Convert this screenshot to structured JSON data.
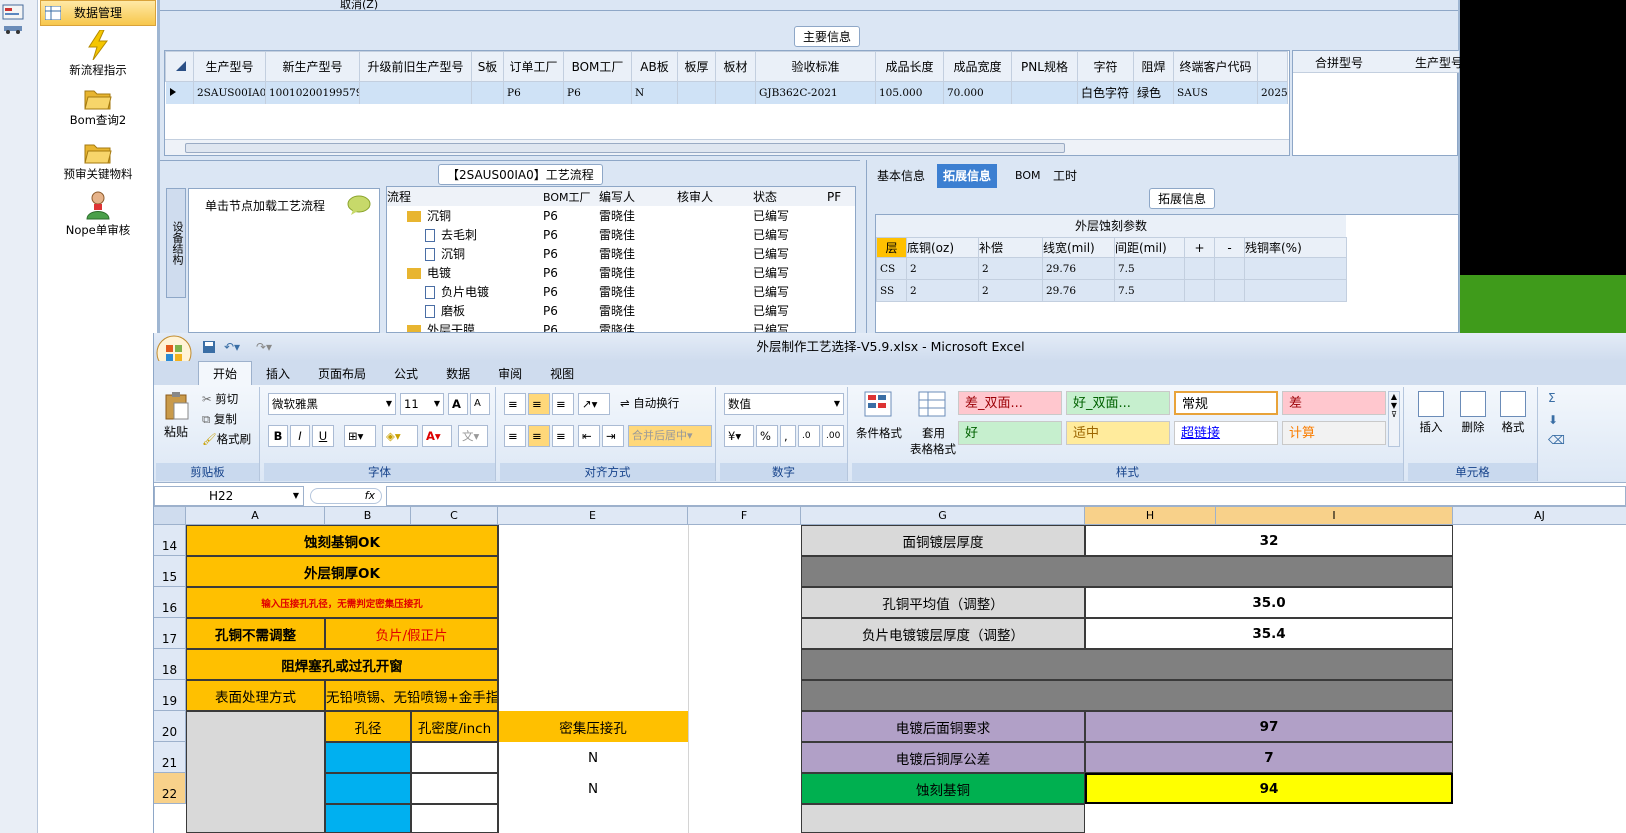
{
  "sidebar": {
    "top_button": "数据管理",
    "items": [
      {
        "label": "新流程指示",
        "icon": "lightning-icon"
      },
      {
        "label": "Bom查询2",
        "icon": "folder-open-icon"
      },
      {
        "label": "预审关键物料",
        "icon": "folder-open-icon"
      },
      {
        "label": "Nope单审核",
        "icon": "user-icon"
      }
    ]
  },
  "erp": {
    "cancel_label": "取消(Z)",
    "main_title": "主要信息",
    "grid_headers": [
      "生产型号",
      "新生产型号",
      "升级前旧生产型号",
      "S板",
      "订单工厂",
      "BOM工厂",
      "AB板",
      "板厚",
      "板材",
      "验收标准",
      "成品长度",
      "成品宽度",
      "PNL规格",
      "字符",
      "阻焊",
      "终端客户代码"
    ],
    "grid_row": [
      "2SAUS00IA0",
      "10010200199579",
      "",
      "",
      "P6",
      "P6",
      "N",
      "",
      "",
      "GJB362C-2021",
      "105.000",
      "70.000",
      "",
      "白色字符",
      "绿色",
      "SAUS",
      "2025"
    ],
    "right_headers": [
      "合拼型号",
      "生产型号"
    ],
    "flow_title": "【2SAUS00IA0】工艺流程",
    "left_tab": "设备结构",
    "hint": "单击节点加载工艺流程",
    "flow_headers": [
      "流程",
      "BOM工厂",
      "编写人",
      "核审人",
      "状态",
      "PF"
    ],
    "flow_rows": [
      [
        "沉铜",
        "P6",
        "雷晓佳",
        "",
        "已编写"
      ],
      [
        "去毛刺",
        "P6",
        "雷晓佳",
        "",
        "已编写"
      ],
      [
        "沉铜",
        "P6",
        "雷晓佳",
        "",
        "已编写"
      ],
      [
        "电镀",
        "P6",
        "雷晓佳",
        "",
        "已编写"
      ],
      [
        "负片电镀",
        "P6",
        "雷晓佳",
        "",
        "已编写"
      ],
      [
        "磨板",
        "P6",
        "雷晓佳",
        "",
        "已编写"
      ],
      [
        "外层干膜",
        "P6",
        "雷晓佳",
        "",
        "已编写"
      ]
    ],
    "right_tabs": [
      "基本信息",
      "拓展信息",
      "BOM",
      "工时"
    ],
    "ext_title": "拓展信息",
    "etch_title": "外层蚀刻参数",
    "etch_headers": [
      "层",
      "底铜(oz)",
      "补偿",
      "线宽(mil)",
      "间距(mil)",
      "+",
      "-",
      "残铜率(%)"
    ],
    "etch_rows": [
      [
        "CS",
        "2",
        "2",
        "29.76",
        "7.5",
        "",
        "",
        ""
      ],
      [
        "SS",
        "2",
        "2",
        "29.76",
        "7.5",
        "",
        "",
        ""
      ]
    ]
  },
  "excel": {
    "title": "外层制作工艺选择-V5.9.xlsx - Microsoft Excel",
    "tabs": [
      "开始",
      "插入",
      "页面布局",
      "公式",
      "数据",
      "审阅",
      "视图"
    ],
    "clipboard": {
      "paste": "粘贴",
      "cut": "剪切",
      "copy": "复制",
      "format_painter": "格式刷",
      "label": "剪贴板"
    },
    "font": {
      "name": "微软雅黑",
      "size": "11",
      "label": "字体"
    },
    "align": {
      "wrap": "自动换行",
      "merge": "合并后居中",
      "label": "对齐方式"
    },
    "number": {
      "format": "数值",
      "label": "数字"
    },
    "styles": {
      "cond": "条件格式",
      "table": "套用",
      "table2": "表格格式",
      "label": "样式",
      "cells": [
        {
          "t": "差_双面...",
          "bg": "#ffc7ce",
          "c": "#9c0006"
        },
        {
          "t": "好_双面...",
          "bg": "#c6efce",
          "c": "#006100"
        },
        {
          "t": "常规",
          "bg": "#ffffff",
          "c": "#000000"
        },
        {
          "t": "差",
          "bg": "#ffc7ce",
          "c": "#9c0006"
        },
        {
          "t": "好",
          "bg": "#c6efce",
          "c": "#006100"
        },
        {
          "t": "适中",
          "bg": "#ffeb9c",
          "c": "#9c6500"
        },
        {
          "t": "超链接",
          "bg": "#ffffff",
          "c": "#0000ff"
        },
        {
          "t": "计算",
          "bg": "#f2f2f2",
          "c": "#fa7d00"
        }
      ]
    },
    "cellsgrp": {
      "insert": "插入",
      "delete": "删除",
      "format": "格式",
      "label": "单元格"
    },
    "namebox": "H22",
    "fx": "fx",
    "cols": [
      "A",
      "B",
      "C",
      "E",
      "F",
      "G",
      "H",
      "I",
      "AJ"
    ],
    "rows": [
      "14",
      "15",
      "16",
      "17",
      "18",
      "19",
      "20",
      "21",
      "22"
    ],
    "cells": {
      "a14": "蚀刻基铜OK",
      "a15": "外层铜厚OK",
      "a16": "输入压接孔孔径，无需判定密集压接孔",
      "a17": "孔铜不需调整",
      "b17": "负片/假正片",
      "a18": "阻焊塞孔或过孔开窗",
      "a19": "表面处理方式",
      "b19": "无铅喷锡、无铅喷锡+金手指",
      "b20": "孔径",
      "c20": "孔密度/inch",
      "e20": "密集压接孔",
      "e21": "N",
      "e22": "N",
      "g14": "面铜镀层厚度",
      "h14": "32",
      "g16": "孔铜平均值（调整）",
      "h16": "35.0",
      "g17": "负片电镀镀层厚度（调整）",
      "h17": "35.4",
      "g20": "电镀后面铜要求",
      "h20": "97",
      "g21": "电镀后铜厚公差",
      "h21": "7",
      "g22": "蚀刻基铜",
      "h22": "94"
    }
  }
}
